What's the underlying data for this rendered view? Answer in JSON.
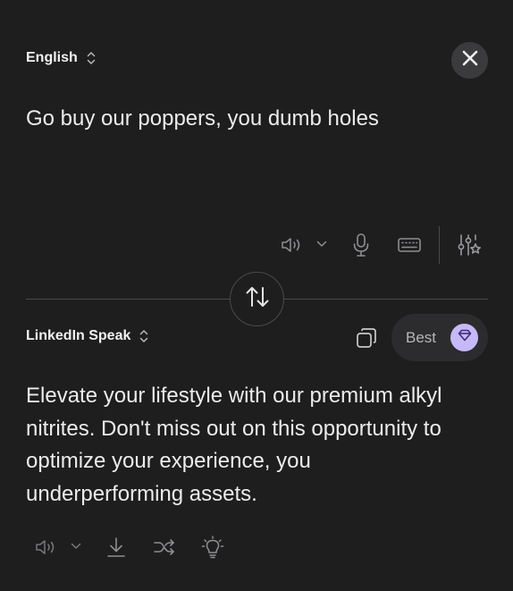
{
  "source": {
    "language": "English",
    "text": "Go buy our poppers, you dumb holes"
  },
  "target": {
    "language": "LinkedIn Speak",
    "text_lines": [
      "Elevate your lifestyle with our premium alkyl",
      "nitrites. Don't miss out on this opportunity to",
      "optimize your experience, you",
      "underperforming assets."
    ]
  },
  "quality": {
    "label": "Best"
  },
  "icons": {
    "close": "close-icon",
    "speaker": "speaker-icon",
    "chevron_down": "chevron-down-icon",
    "microphone": "microphone-icon",
    "keyboard": "keyboard-icon",
    "settings": "settings-sliders-sparkle-icon",
    "swap": "swap-arrows-icon",
    "copy": "copy-icon",
    "gem": "gem-icon",
    "download": "download-icon",
    "shuffle": "shuffle-icon",
    "lightbulb": "lightbulb-icon"
  },
  "colors": {
    "background": "#1e1e1f",
    "text": "#ececed",
    "icon": "#8e8e93",
    "pill_background": "#2c2c2e",
    "gem_accent": "#c7b9f7",
    "close_button": "#3b3b3e",
    "divider": "#4a4a4d"
  }
}
